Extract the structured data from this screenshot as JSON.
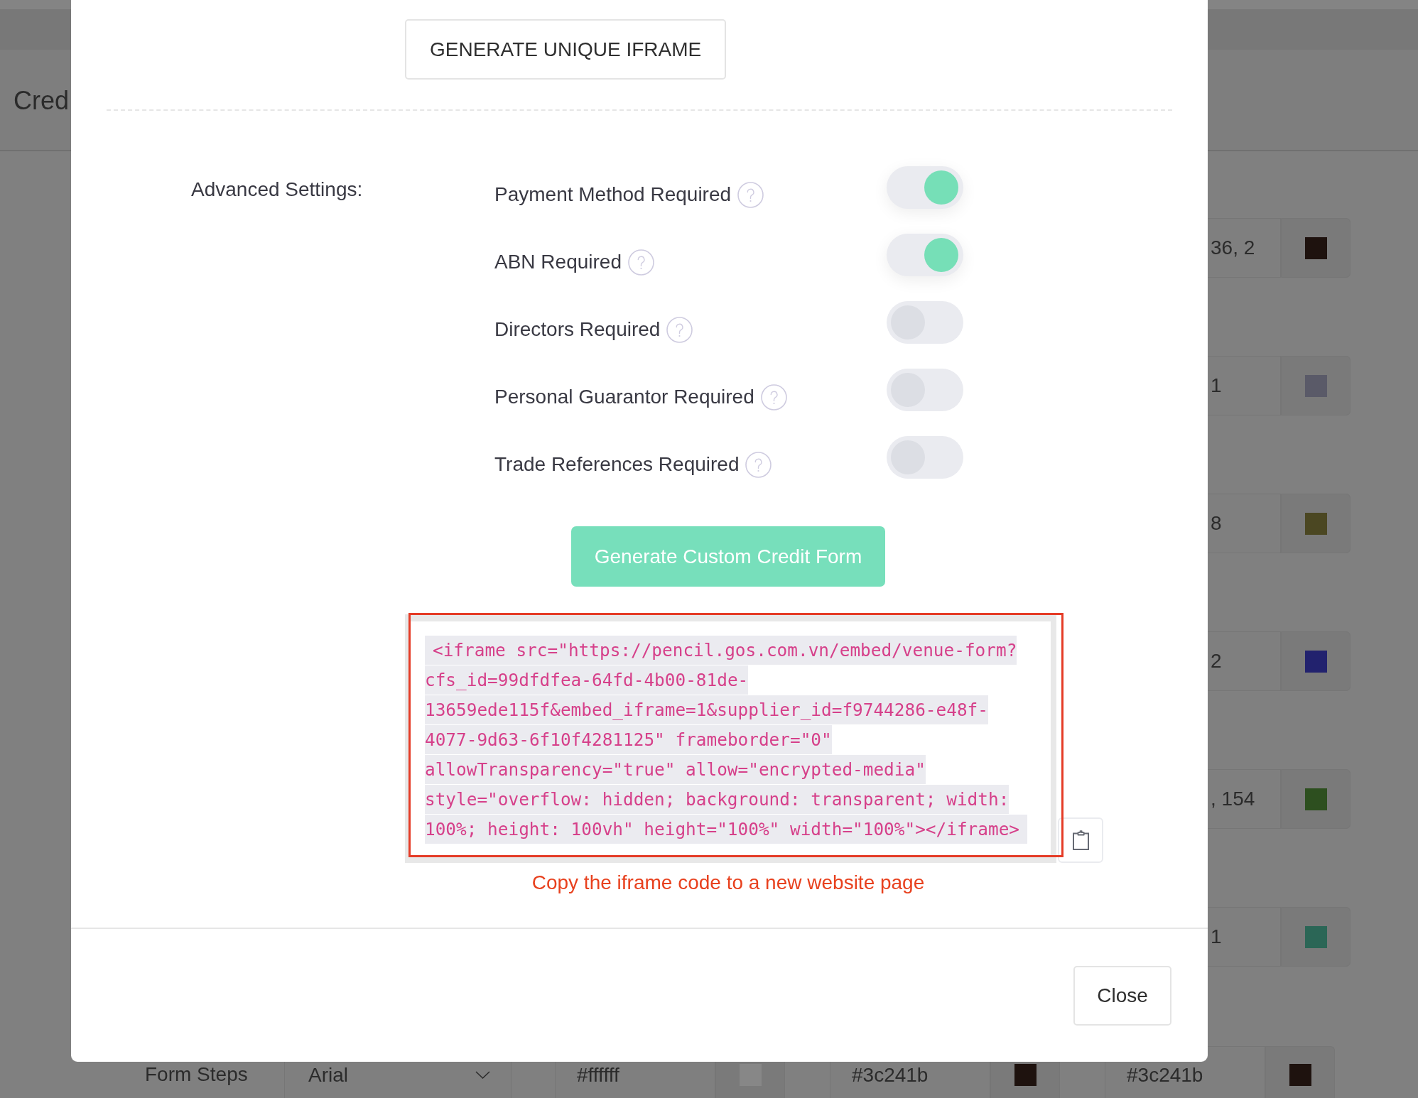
{
  "page": {
    "title": "Cred",
    "color_fields": [
      {
        "value": "36, 2",
        "color": "#1e120e"
      },
      {
        "value": "1",
        "color": "#5a5a68"
      },
      {
        "value": "8",
        "color": "#4b4722"
      },
      {
        "value": "2",
        "color": "#22226e"
      },
      {
        "value": ", 154",
        "color": "#2d4f1f"
      },
      {
        "value": "1",
        "color": "#2b6656"
      }
    ],
    "form_steps_row": {
      "label": "Form Steps",
      "font": "Arial",
      "color_fields": [
        {
          "value": "#ffffff",
          "color": "#878787"
        },
        {
          "value": "#3c241b",
          "color": "#1e120e"
        },
        {
          "value": "#3c241b",
          "color": "#1e120e"
        }
      ]
    }
  },
  "modal": {
    "generate_iframe_button": "GENERATE UNIQUE IFRAME",
    "advanced_settings": {
      "label": "Advanced Settings:",
      "options": [
        {
          "label": "Payment Method Required",
          "on": true
        },
        {
          "label": "ABN Required",
          "on": true
        },
        {
          "label": "Directors Required",
          "on": false
        },
        {
          "label": "Personal Guarantor Required",
          "on": false
        },
        {
          "label": "Trade References Required",
          "on": false
        }
      ]
    },
    "generate_form_button": "Generate Custom Credit Form",
    "iframe_code": "<iframe src=\"https://pencil.gos.com.vn/embed/venue-form?cfs_id=99dfdfea-64fd-4b00-81de-13659ede115f&embed_iframe=1&supplier_id=f9744286-e48f-4077-9d63-6f10f4281125\" frameborder=\"0\" allowTransparency=\"true\" allow=\"encrypted-media\" style=\"overflow: hidden; background: transparent; width: 100%; height: 100vh\" height=\"100%\" width=\"100%\"></iframe>",
    "copy_hint": "Copy the iframe code to a new website page",
    "close_button": "Close"
  }
}
